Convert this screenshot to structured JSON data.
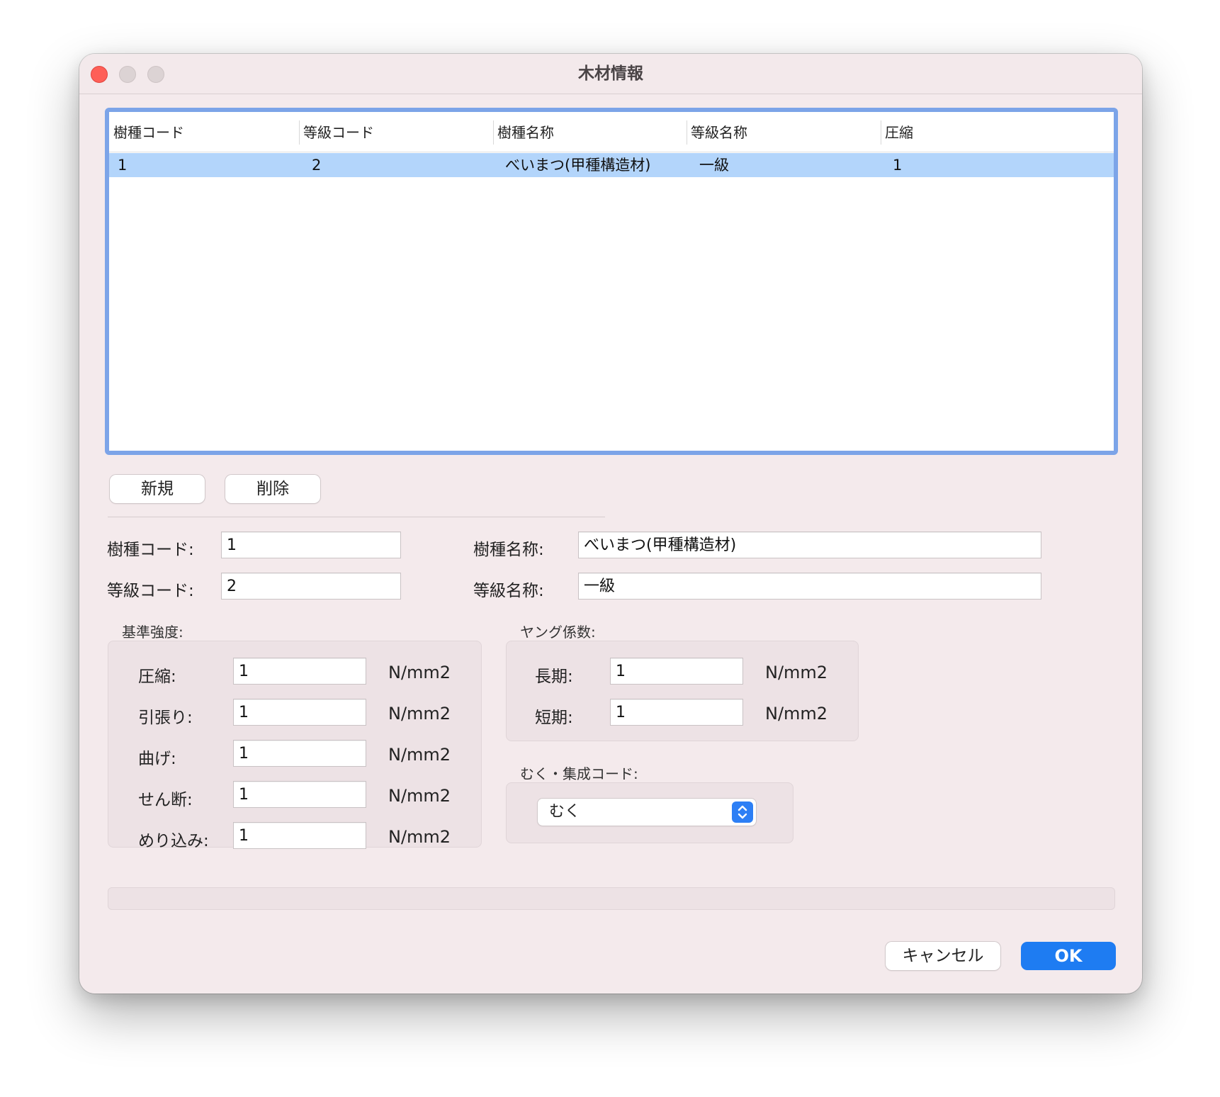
{
  "window": {
    "title": "木材情報"
  },
  "table": {
    "columns": [
      "樹種コード",
      "等級コード",
      "樹種名称",
      "等級名称",
      "圧縮"
    ],
    "rows": [
      {
        "species_code": "1",
        "grade_code": "2",
        "species_name": "べいまつ(甲種構造材)",
        "grade_name": "一級",
        "compression": "1"
      }
    ]
  },
  "buttons": {
    "new": "新規",
    "delete": "削除",
    "cancel": "キャンセル",
    "ok": "OK"
  },
  "form": {
    "species_code_label": "樹種コード:",
    "species_code_value": "1",
    "grade_code_label": "等級コード:",
    "grade_code_value": "2",
    "species_name_label": "樹種名称:",
    "species_name_value": "べいまつ(甲種構造材)",
    "grade_name_label": "等級名称:",
    "grade_name_value": "一級"
  },
  "strength": {
    "group_label": "基準強度:",
    "rows": [
      {
        "label": "圧縮:",
        "value": "1",
        "unit": "N/mm2"
      },
      {
        "label": "引張り:",
        "value": "1",
        "unit": "N/mm2"
      },
      {
        "label": "曲げ:",
        "value": "1",
        "unit": "N/mm2"
      },
      {
        "label": "せん断:",
        "value": "1",
        "unit": "N/mm2"
      },
      {
        "label": "めり込み:",
        "value": "1",
        "unit": "N/mm2"
      }
    ]
  },
  "young": {
    "group_label": "ヤング係数:",
    "rows": [
      {
        "label": "長期:",
        "value": "1",
        "unit": "N/mm2"
      },
      {
        "label": "短期:",
        "value": "1",
        "unit": "N/mm2"
      }
    ]
  },
  "solid_glulam": {
    "group_label": "むく・集成コード:",
    "selected": "むく"
  },
  "colors": {
    "accent": "#1e7cf2",
    "selection": "#b3d5fb",
    "table_focus_ring": "#7ca4e8",
    "window_bg": "#f4eaec"
  }
}
